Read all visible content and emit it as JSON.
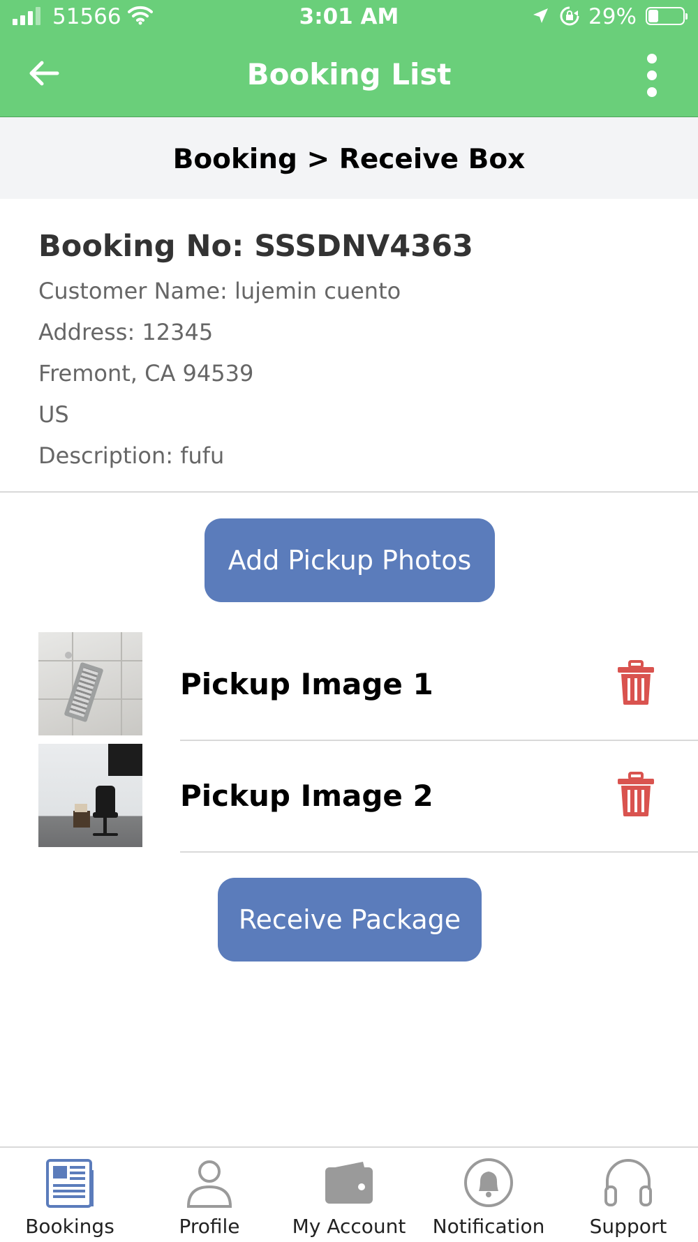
{
  "status_bar": {
    "carrier": "51566",
    "time": "3:01 AM",
    "battery": "29%",
    "battery_level": 0.29
  },
  "app_bar": {
    "title": "Booking List",
    "back_icon": "arrow-left-icon",
    "menu_icon": "more-vertical-icon"
  },
  "breadcrumb": "Booking > Receive Box",
  "booking": {
    "number": "Booking No: SSSDNV4363",
    "customer": "Customer Name: lujemin cuento",
    "address1": "Address: 12345",
    "address2": "Fremont, CA 94539",
    "country": "US",
    "description": "Description: fufu"
  },
  "actions": {
    "add_photos": "Add Pickup Photos",
    "receive": "Receive Package"
  },
  "photos": [
    {
      "label": "Pickup Image 1",
      "icon": "trash-icon"
    },
    {
      "label": "Pickup Image 2",
      "icon": "trash-icon"
    }
  ],
  "tabs": [
    {
      "label": "Bookings",
      "icon": "bookings-icon",
      "active": true
    },
    {
      "label": "Profile",
      "icon": "profile-icon"
    },
    {
      "label": "My Account",
      "icon": "wallet-icon"
    },
    {
      "label": "Notification",
      "icon": "bell-icon"
    },
    {
      "label": "Support",
      "icon": "headphones-icon"
    }
  ],
  "colors": {
    "header": "#6acf7a",
    "button": "#5b7cbb",
    "delete": "#d9534f",
    "active_tab": "#5b7cbb",
    "inactive_tab": "#9a9a9a"
  }
}
